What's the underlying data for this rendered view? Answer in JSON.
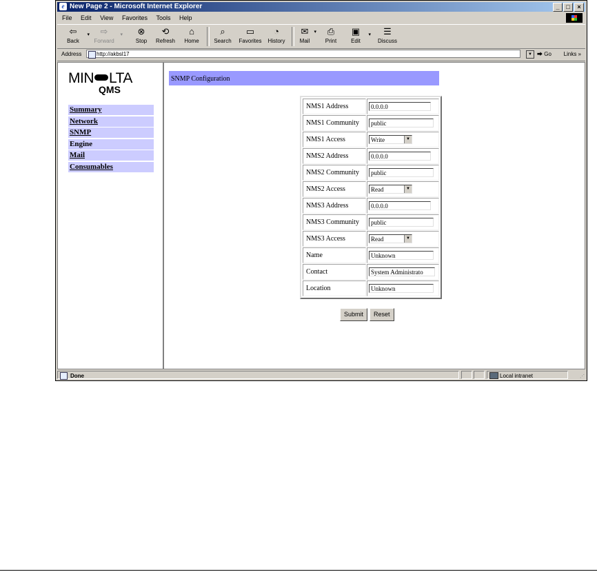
{
  "window": {
    "title": "New Page 2 - Microsoft Internet Explorer",
    "controls": [
      "_",
      "□",
      "×"
    ]
  },
  "menu": [
    "File",
    "Edit",
    "View",
    "Favorites",
    "Tools",
    "Help"
  ],
  "toolbar": {
    "back": "Back",
    "forward": "Forward",
    "stop": "Stop",
    "refresh": "Refresh",
    "home": "Home",
    "search": "Search",
    "favorites": "Favorites",
    "history": "History",
    "mail": "Mail",
    "print": "Print",
    "edit": "Edit",
    "discuss": "Discuss"
  },
  "address": {
    "label": "Address",
    "url": "http://akbsl17",
    "go": "Go",
    "links": "Links »"
  },
  "logo": {
    "line1a": "MIN",
    "line1b": "LTA",
    "line2": "QMS"
  },
  "nav": [
    "Summary",
    "Network",
    "SNMP",
    "Engine",
    "Mail",
    "Consumables"
  ],
  "page": {
    "heading": "SNMP Configuration"
  },
  "form": {
    "rows": [
      {
        "label": "NMS1 Address",
        "value": "0.0.0.0"
      },
      {
        "label": "NMS1 Community",
        "value": "public"
      },
      {
        "label": "NMS1 Access",
        "value": "Write"
      },
      {
        "label": "NMS2 Address",
        "value": "0.0.0.0"
      },
      {
        "label": "NMS2 Community",
        "value": "public"
      },
      {
        "label": "NMS2 Access",
        "value": "Read"
      },
      {
        "label": "NMS3 Address",
        "value": "0.0.0.0"
      },
      {
        "label": "NMS3 Community",
        "value": "public"
      },
      {
        "label": "NMS3 Access",
        "value": "Read"
      },
      {
        "label": "Name",
        "value": "Unknown"
      },
      {
        "label": "Contact",
        "value": "System Administrato"
      },
      {
        "label": "Location",
        "value": "Unknown"
      }
    ],
    "submit": "Submit",
    "reset": "Reset"
  },
  "status": {
    "text": "Done",
    "zone": "Local intranet"
  }
}
